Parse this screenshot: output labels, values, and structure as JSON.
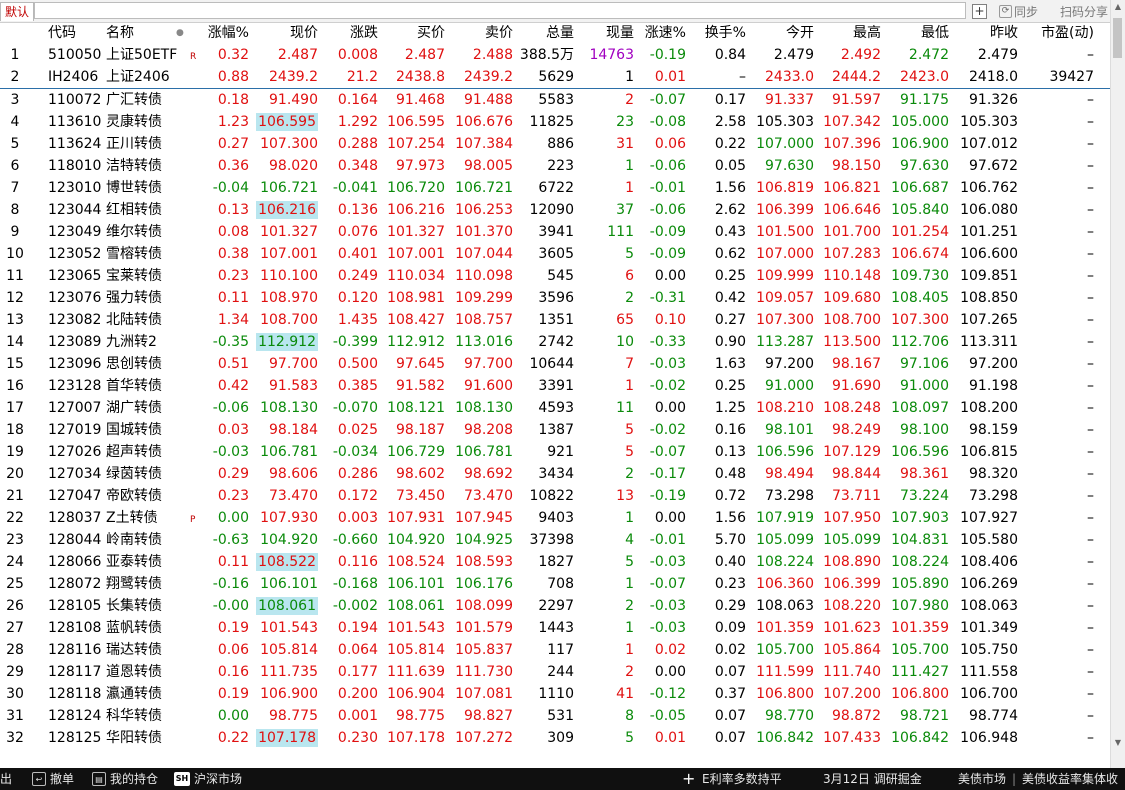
{
  "topbar": {
    "tab_label": "默认",
    "search_value": "",
    "add_label": "+",
    "sync_label": "同步",
    "share_label": "扫码分享"
  },
  "columns": [
    "代码",
    "名称",
    "涨幅%",
    "现价",
    "涨跌",
    "买价",
    "卖价",
    "总量",
    "现量",
    "涨速%",
    "换手%",
    "今开",
    "最高",
    "最低",
    "昨收",
    "市盈(动)"
  ],
  "rows": [
    {
      "idx": "1",
      "code": "510050",
      "name": "上证50ETF",
      "flag": "R",
      "chg": "0.32",
      "price": "2.487",
      "diff": "0.008",
      "bid": "2.487",
      "ask": "2.488",
      "vol": "388.5万",
      "curv": "14763",
      "spd": "-0.19",
      "turn": "0.84",
      "open": "2.479",
      "high": "2.492",
      "low": "2.472",
      "prev": "2.479",
      "pe": "–",
      "hl": false,
      "curv_color": "purple"
    },
    {
      "idx": "2",
      "code": "IH2406",
      "name": "上证2406",
      "flag": "",
      "chg": "0.88",
      "price": "2439.2",
      "diff": "21.2",
      "bid": "2438.8",
      "ask": "2439.2",
      "vol": "5629",
      "curv": "1",
      "spd": "0.01",
      "turn": "–",
      "open": "2433.0",
      "high": "2444.2",
      "low": "2423.0",
      "prev": "2418.0",
      "pe": "39427",
      "hl": false,
      "curv_color": "black"
    },
    {
      "idx": "3",
      "code": "110072",
      "name": "广汇转债",
      "flag": "",
      "chg": "0.18",
      "price": "91.490",
      "diff": "0.164",
      "bid": "91.468",
      "ask": "91.488",
      "vol": "5583",
      "curv": "2",
      "spd": "-0.07",
      "turn": "0.17",
      "open": "91.337",
      "high": "91.597",
      "low": "91.175",
      "prev": "91.326",
      "pe": "–",
      "hl": false,
      "curv_color": "red"
    },
    {
      "idx": "4",
      "code": "113610",
      "name": "灵康转债",
      "flag": "",
      "chg": "1.23",
      "price": "106.595",
      "diff": "1.292",
      "bid": "106.595",
      "ask": "106.676",
      "vol": "11825",
      "curv": "23",
      "spd": "-0.08",
      "turn": "2.58",
      "open": "105.303",
      "high": "107.342",
      "low": "105.000",
      "prev": "105.303",
      "pe": "–",
      "hl": true,
      "curv_color": "green"
    },
    {
      "idx": "5",
      "code": "113624",
      "name": "正川转债",
      "flag": "",
      "chg": "0.27",
      "price": "107.300",
      "diff": "0.288",
      "bid": "107.254",
      "ask": "107.384",
      "vol": "886",
      "curv": "31",
      "spd": "0.06",
      "turn": "0.22",
      "open": "107.000",
      "high": "107.396",
      "low": "106.900",
      "prev": "107.012",
      "pe": "–",
      "hl": false,
      "curv_color": "red"
    },
    {
      "idx": "6",
      "code": "118010",
      "name": "洁特转债",
      "flag": "",
      "chg": "0.36",
      "price": "98.020",
      "diff": "0.348",
      "bid": "97.973",
      "ask": "98.005",
      "vol": "223",
      "curv": "1",
      "spd": "-0.06",
      "turn": "0.05",
      "open": "97.630",
      "high": "98.150",
      "low": "97.630",
      "prev": "97.672",
      "pe": "–",
      "hl": false,
      "curv_color": "green"
    },
    {
      "idx": "7",
      "code": "123010",
      "name": "博世转债",
      "flag": "",
      "chg": "-0.04",
      "price": "106.721",
      "diff": "-0.041",
      "bid": "106.720",
      "ask": "106.721",
      "vol": "6722",
      "curv": "1",
      "spd": "-0.01",
      "turn": "1.56",
      "open": "106.819",
      "high": "106.821",
      "low": "106.687",
      "prev": "106.762",
      "pe": "–",
      "hl": false,
      "curv_color": "red"
    },
    {
      "idx": "8",
      "code": "123044",
      "name": "红相转债",
      "flag": "",
      "chg": "0.13",
      "price": "106.216",
      "diff": "0.136",
      "bid": "106.216",
      "ask": "106.253",
      "vol": "12090",
      "curv": "37",
      "spd": "-0.06",
      "turn": "2.62",
      "open": "106.399",
      "high": "106.646",
      "low": "105.840",
      "prev": "106.080",
      "pe": "–",
      "hl": true,
      "curv_color": "green"
    },
    {
      "idx": "9",
      "code": "123049",
      "name": "维尔转债",
      "flag": "",
      "chg": "0.08",
      "price": "101.327",
      "diff": "0.076",
      "bid": "101.327",
      "ask": "101.370",
      "vol": "3941",
      "curv": "111",
      "spd": "-0.09",
      "turn": "0.43",
      "open": "101.500",
      "high": "101.700",
      "low": "101.254",
      "prev": "101.251",
      "pe": "–",
      "hl": false,
      "curv_color": "green"
    },
    {
      "idx": "10",
      "code": "123052",
      "name": "雪榕转债",
      "flag": "",
      "chg": "0.38",
      "price": "107.001",
      "diff": "0.401",
      "bid": "107.001",
      "ask": "107.044",
      "vol": "3605",
      "curv": "5",
      "spd": "-0.09",
      "turn": "0.62",
      "open": "107.000",
      "high": "107.283",
      "low": "106.674",
      "prev": "106.600",
      "pe": "–",
      "hl": false,
      "curv_color": "green"
    },
    {
      "idx": "11",
      "code": "123065",
      "name": "宝莱转债",
      "flag": "",
      "chg": "0.23",
      "price": "110.100",
      "diff": "0.249",
      "bid": "110.034",
      "ask": "110.098",
      "vol": "545",
      "curv": "6",
      "spd": "0.00",
      "turn": "0.25",
      "open": "109.999",
      "high": "110.148",
      "low": "109.730",
      "prev": "109.851",
      "pe": "–",
      "hl": false,
      "curv_color": "red"
    },
    {
      "idx": "12",
      "code": "123076",
      "name": "强力转债",
      "flag": "",
      "chg": "0.11",
      "price": "108.970",
      "diff": "0.120",
      "bid": "108.981",
      "ask": "109.299",
      "vol": "3596",
      "curv": "2",
      "spd": "-0.31",
      "turn": "0.42",
      "open": "109.057",
      "high": "109.680",
      "low": "108.405",
      "prev": "108.850",
      "pe": "–",
      "hl": false,
      "curv_color": "green"
    },
    {
      "idx": "13",
      "code": "123082",
      "name": "北陆转债",
      "flag": "",
      "chg": "1.34",
      "price": "108.700",
      "diff": "1.435",
      "bid": "108.427",
      "ask": "108.757",
      "vol": "1351",
      "curv": "65",
      "spd": "0.10",
      "turn": "0.27",
      "open": "107.300",
      "high": "108.700",
      "low": "107.300",
      "prev": "107.265",
      "pe": "–",
      "hl": false,
      "curv_color": "red"
    },
    {
      "idx": "14",
      "code": "123089",
      "name": "九洲转2",
      "flag": "",
      "chg": "-0.35",
      "price": "112.912",
      "diff": "-0.399",
      "bid": "112.912",
      "ask": "113.016",
      "vol": "2742",
      "curv": "10",
      "spd": "-0.33",
      "turn": "0.90",
      "open": "113.287",
      "high": "113.500",
      "low": "112.706",
      "prev": "113.311",
      "pe": "–",
      "hl": true,
      "curv_color": "green"
    },
    {
      "idx": "15",
      "code": "123096",
      "name": "思创转债",
      "flag": "",
      "chg": "0.51",
      "price": "97.700",
      "diff": "0.500",
      "bid": "97.645",
      "ask": "97.700",
      "vol": "10644",
      "curv": "7",
      "spd": "-0.03",
      "turn": "1.63",
      "open": "97.200",
      "high": "98.167",
      "low": "97.106",
      "prev": "97.200",
      "pe": "–",
      "hl": false,
      "curv_color": "red"
    },
    {
      "idx": "16",
      "code": "123128",
      "name": "首华转债",
      "flag": "",
      "chg": "0.42",
      "price": "91.583",
      "diff": "0.385",
      "bid": "91.582",
      "ask": "91.600",
      "vol": "3391",
      "curv": "1",
      "spd": "-0.02",
      "turn": "0.25",
      "open": "91.000",
      "high": "91.690",
      "low": "91.000",
      "prev": "91.198",
      "pe": "–",
      "hl": false,
      "curv_color": "red"
    },
    {
      "idx": "17",
      "code": "127007",
      "name": "湖广转债",
      "flag": "",
      "chg": "-0.06",
      "price": "108.130",
      "diff": "-0.070",
      "bid": "108.121",
      "ask": "108.130",
      "vol": "4593",
      "curv": "11",
      "spd": "0.00",
      "turn": "1.25",
      "open": "108.210",
      "high": "108.248",
      "low": "108.097",
      "prev": "108.200",
      "pe": "–",
      "hl": false,
      "curv_color": "green"
    },
    {
      "idx": "18",
      "code": "127019",
      "name": "国城转债",
      "flag": "",
      "chg": "0.03",
      "price": "98.184",
      "diff": "0.025",
      "bid": "98.187",
      "ask": "98.208",
      "vol": "1387",
      "curv": "5",
      "spd": "-0.02",
      "turn": "0.16",
      "open": "98.101",
      "high": "98.249",
      "low": "98.100",
      "prev": "98.159",
      "pe": "–",
      "hl": false,
      "curv_color": "red"
    },
    {
      "idx": "19",
      "code": "127026",
      "name": "超声转债",
      "flag": "",
      "chg": "-0.03",
      "price": "106.781",
      "diff": "-0.034",
      "bid": "106.729",
      "ask": "106.781",
      "vol": "921",
      "curv": "5",
      "spd": "-0.07",
      "turn": "0.13",
      "open": "106.596",
      "high": "107.129",
      "low": "106.596",
      "prev": "106.815",
      "pe": "–",
      "hl": false,
      "curv_color": "red"
    },
    {
      "idx": "20",
      "code": "127034",
      "name": "绿茵转债",
      "flag": "",
      "chg": "0.29",
      "price": "98.606",
      "diff": "0.286",
      "bid": "98.602",
      "ask": "98.692",
      "vol": "3434",
      "curv": "2",
      "spd": "-0.17",
      "turn": "0.48",
      "open": "98.494",
      "high": "98.844",
      "low": "98.361",
      "prev": "98.320",
      "pe": "–",
      "hl": false,
      "curv_color": "green"
    },
    {
      "idx": "21",
      "code": "127047",
      "name": "帝欧转债",
      "flag": "",
      "chg": "0.23",
      "price": "73.470",
      "diff": "0.172",
      "bid": "73.450",
      "ask": "73.470",
      "vol": "10822",
      "curv": "13",
      "spd": "-0.19",
      "turn": "0.72",
      "open": "73.298",
      "high": "73.711",
      "low": "73.224",
      "prev": "73.298",
      "pe": "–",
      "hl": false,
      "curv_color": "red"
    },
    {
      "idx": "22",
      "code": "128037",
      "name": "Z土转债",
      "flag": "P",
      "chg": "0.00",
      "price": "107.930",
      "diff": "0.003",
      "bid": "107.931",
      "ask": "107.945",
      "vol": "9403",
      "curv": "1",
      "spd": "0.00",
      "turn": "1.56",
      "open": "107.919",
      "high": "107.950",
      "low": "107.903",
      "prev": "107.927",
      "pe": "–",
      "hl": false,
      "curv_color": "green"
    },
    {
      "idx": "23",
      "code": "128044",
      "name": "岭南转债",
      "flag": "",
      "chg": "-0.63",
      "price": "104.920",
      "diff": "-0.660",
      "bid": "104.920",
      "ask": "104.925",
      "vol": "37398",
      "curv": "4",
      "spd": "-0.01",
      "turn": "5.70",
      "open": "105.099",
      "high": "105.099",
      "low": "104.831",
      "prev": "105.580",
      "pe": "–",
      "hl": false,
      "curv_color": "green"
    },
    {
      "idx": "24",
      "code": "128066",
      "name": "亚泰转债",
      "flag": "",
      "chg": "0.11",
      "price": "108.522",
      "diff": "0.116",
      "bid": "108.524",
      "ask": "108.593",
      "vol": "1827",
      "curv": "5",
      "spd": "-0.03",
      "turn": "0.40",
      "open": "108.224",
      "high": "108.890",
      "low": "108.224",
      "prev": "108.406",
      "pe": "–",
      "hl": true,
      "curv_color": "green"
    },
    {
      "idx": "25",
      "code": "128072",
      "name": "翔鹭转债",
      "flag": "",
      "chg": "-0.16",
      "price": "106.101",
      "diff": "-0.168",
      "bid": "106.101",
      "ask": "106.176",
      "vol": "708",
      "curv": "1",
      "spd": "-0.07",
      "turn": "0.23",
      "open": "106.360",
      "high": "106.399",
      "low": "105.890",
      "prev": "106.269",
      "pe": "–",
      "hl": false,
      "curv_color": "green"
    },
    {
      "idx": "26",
      "code": "128105",
      "name": "长集转债",
      "flag": "",
      "chg": "-0.00",
      "price": "108.061",
      "diff": "-0.002",
      "bid": "108.061",
      "ask": "108.099",
      "vol": "2297",
      "curv": "2",
      "spd": "-0.03",
      "turn": "0.29",
      "open": "108.063",
      "high": "108.220",
      "low": "107.980",
      "prev": "108.063",
      "pe": "–",
      "hl": true,
      "curv_color": "green"
    },
    {
      "idx": "27",
      "code": "128108",
      "name": "蓝帆转债",
      "flag": "",
      "chg": "0.19",
      "price": "101.543",
      "diff": "0.194",
      "bid": "101.543",
      "ask": "101.579",
      "vol": "1443",
      "curv": "1",
      "spd": "-0.03",
      "turn": "0.09",
      "open": "101.359",
      "high": "101.623",
      "low": "101.359",
      "prev": "101.349",
      "pe": "–",
      "hl": false,
      "curv_color": "green"
    },
    {
      "idx": "28",
      "code": "128116",
      "name": "瑞达转债",
      "flag": "",
      "chg": "0.06",
      "price": "105.814",
      "diff": "0.064",
      "bid": "105.814",
      "ask": "105.837",
      "vol": "117",
      "curv": "1",
      "spd": "0.02",
      "turn": "0.02",
      "open": "105.700",
      "high": "105.864",
      "low": "105.700",
      "prev": "105.750",
      "pe": "–",
      "hl": false,
      "curv_color": "red"
    },
    {
      "idx": "29",
      "code": "128117",
      "name": "道恩转债",
      "flag": "",
      "chg": "0.16",
      "price": "111.735",
      "diff": "0.177",
      "bid": "111.639",
      "ask": "111.730",
      "vol": "244",
      "curv": "2",
      "spd": "0.00",
      "turn": "0.07",
      "open": "111.599",
      "high": "111.740",
      "low": "111.427",
      "prev": "111.558",
      "pe": "–",
      "hl": false,
      "curv_color": "red"
    },
    {
      "idx": "30",
      "code": "128118",
      "name": "瀛通转债",
      "flag": "",
      "chg": "0.19",
      "price": "106.900",
      "diff": "0.200",
      "bid": "106.904",
      "ask": "107.081",
      "vol": "1110",
      "curv": "41",
      "spd": "-0.12",
      "turn": "0.37",
      "open": "106.800",
      "high": "107.200",
      "low": "106.800",
      "prev": "106.700",
      "pe": "–",
      "hl": false,
      "curv_color": "red"
    },
    {
      "idx": "31",
      "code": "128124",
      "name": "科华转债",
      "flag": "",
      "chg": "0.00",
      "price": "98.775",
      "diff": "0.001",
      "bid": "98.775",
      "ask": "98.827",
      "vol": "531",
      "curv": "8",
      "spd": "-0.05",
      "turn": "0.07",
      "open": "98.770",
      "high": "98.872",
      "low": "98.721",
      "prev": "98.774",
      "pe": "–",
      "hl": false,
      "curv_color": "green"
    },
    {
      "idx": "32",
      "code": "128125",
      "name": "华阳转债",
      "flag": "",
      "chg": "0.22",
      "price": "107.178",
      "diff": "0.230",
      "bid": "107.178",
      "ask": "107.272",
      "vol": "309",
      "curv": "5",
      "spd": "0.01",
      "turn": "0.07",
      "open": "106.842",
      "high": "107.433",
      "low": "106.842",
      "prev": "106.948",
      "pe": "–",
      "hl": true,
      "curv_color": "green"
    }
  ],
  "bottombar": {
    "item0": "出",
    "undo_label": "撤单",
    "holdings_label": "我的持仓",
    "market_icon": "SH",
    "market_label": "沪深市场",
    "plus_label": "+",
    "ticker1": "E利率多数持平",
    "ticker2": "3月12日 调研掘金",
    "ticker3": "美债市场",
    "sep": "|",
    "ticker4": "美债收益率集体收"
  },
  "colors": {
    "up": "#e01010",
    "down": "#0a8a0a",
    "highlight": "#b9e6ef",
    "bottombar": "#101010"
  }
}
